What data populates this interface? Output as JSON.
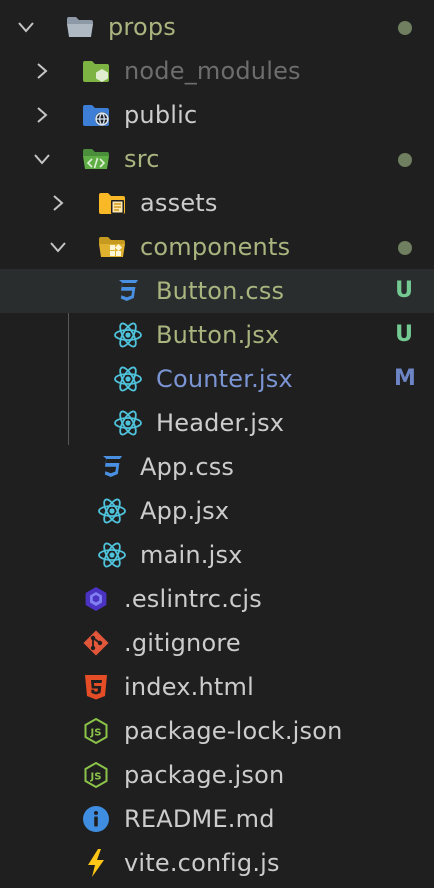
{
  "colors": {
    "background": "#1f1f1f",
    "selected_row": "#2a2d2e",
    "default_text": "#cccccc",
    "untracked_text": "#a9b47f",
    "modified_text": "#7b95d4",
    "ignored_text": "#6d6d6d",
    "untracked_badge": "#73c991",
    "modified_badge": "#6d84c5",
    "dot": "#6f7f5f"
  },
  "tree": [
    {
      "label": "props",
      "depth": 0,
      "type": "folder",
      "expanded": true,
      "icon": "folder-open-icon",
      "status": "untracked",
      "decoration": "dot"
    },
    {
      "label": "node_modules",
      "depth": 1,
      "type": "folder",
      "expanded": false,
      "icon": "node-modules-folder-icon",
      "status": "ignored",
      "decoration": ""
    },
    {
      "label": "public",
      "depth": 1,
      "type": "folder",
      "expanded": false,
      "icon": "public-folder-icon",
      "status": "normal",
      "decoration": ""
    },
    {
      "label": "src",
      "depth": 1,
      "type": "folder",
      "expanded": true,
      "icon": "src-folder-icon",
      "status": "untracked",
      "decoration": "dot"
    },
    {
      "label": "assets",
      "depth": 2,
      "type": "folder",
      "expanded": false,
      "icon": "assets-folder-icon",
      "status": "normal",
      "decoration": ""
    },
    {
      "label": "components",
      "depth": 2,
      "type": "folder",
      "expanded": true,
      "icon": "components-folder-icon",
      "status": "untracked",
      "decoration": "dot"
    },
    {
      "label": "Button.css",
      "depth": 3,
      "type": "file",
      "icon": "css-icon",
      "status": "untracked",
      "decoration": "U",
      "selected": true
    },
    {
      "label": "Button.jsx",
      "depth": 3,
      "type": "file",
      "icon": "react-icon",
      "status": "untracked",
      "decoration": "U"
    },
    {
      "label": "Counter.jsx",
      "depth": 3,
      "type": "file",
      "icon": "react-icon",
      "status": "modified",
      "decoration": "M"
    },
    {
      "label": "Header.jsx",
      "depth": 3,
      "type": "file",
      "icon": "react-icon",
      "status": "normal",
      "decoration": ""
    },
    {
      "label": "App.css",
      "depth": 2,
      "type": "file",
      "icon": "css-icon",
      "status": "normal",
      "decoration": ""
    },
    {
      "label": "App.jsx",
      "depth": 2,
      "type": "file",
      "icon": "react-icon",
      "status": "normal",
      "decoration": ""
    },
    {
      "label": "main.jsx",
      "depth": 2,
      "type": "file",
      "icon": "react-icon",
      "status": "normal",
      "decoration": ""
    },
    {
      "label": ".eslintrc.cjs",
      "depth": 1,
      "type": "file",
      "icon": "eslint-icon",
      "status": "normal",
      "decoration": ""
    },
    {
      "label": ".gitignore",
      "depth": 1,
      "type": "file",
      "icon": "git-icon",
      "status": "normal",
      "decoration": ""
    },
    {
      "label": "index.html",
      "depth": 1,
      "type": "file",
      "icon": "html-icon",
      "status": "normal",
      "decoration": ""
    },
    {
      "label": "package-lock.json",
      "depth": 1,
      "type": "file",
      "icon": "nodejs-icon",
      "status": "normal",
      "decoration": ""
    },
    {
      "label": "package.json",
      "depth": 1,
      "type": "file",
      "icon": "nodejs-icon",
      "status": "normal",
      "decoration": ""
    },
    {
      "label": "README.md",
      "depth": 1,
      "type": "file",
      "icon": "info-icon",
      "status": "normal",
      "decoration": ""
    },
    {
      "label": "vite.config.js",
      "depth": 1,
      "type": "file",
      "icon": "vite-icon",
      "status": "normal",
      "decoration": ""
    }
  ]
}
